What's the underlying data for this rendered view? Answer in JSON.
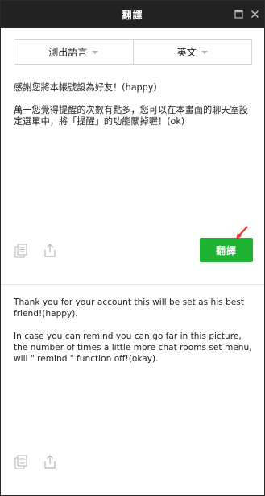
{
  "window": {
    "title": "翻譯"
  },
  "languages": {
    "source_label": "測出語言",
    "target_label": "英文"
  },
  "source": {
    "text": "感謝您將本帳號設為好友！(happy)\n\n萬一您覺得提醒的次數有點多，您可以在本畫面的聊天室設定選單中，將「提醒」的功能關掉喔！(ok)"
  },
  "actions": {
    "translate_label": "翻譯"
  },
  "target": {
    "text": "Thank you for your account this will be set as his best friend!(happy).\n\nIn case you can remind you can go far in this picture, the number of times a little more chat rooms set menu, will \" remind \" function off!(okay)."
  },
  "colors": {
    "titlebar": "#222222",
    "translate_button": "#1fb334",
    "annotation_arrow": "#e53935"
  },
  "icons": {
    "copy": "copy-icon",
    "share": "share-icon",
    "restore": "restore-icon",
    "close": "close-icon"
  }
}
